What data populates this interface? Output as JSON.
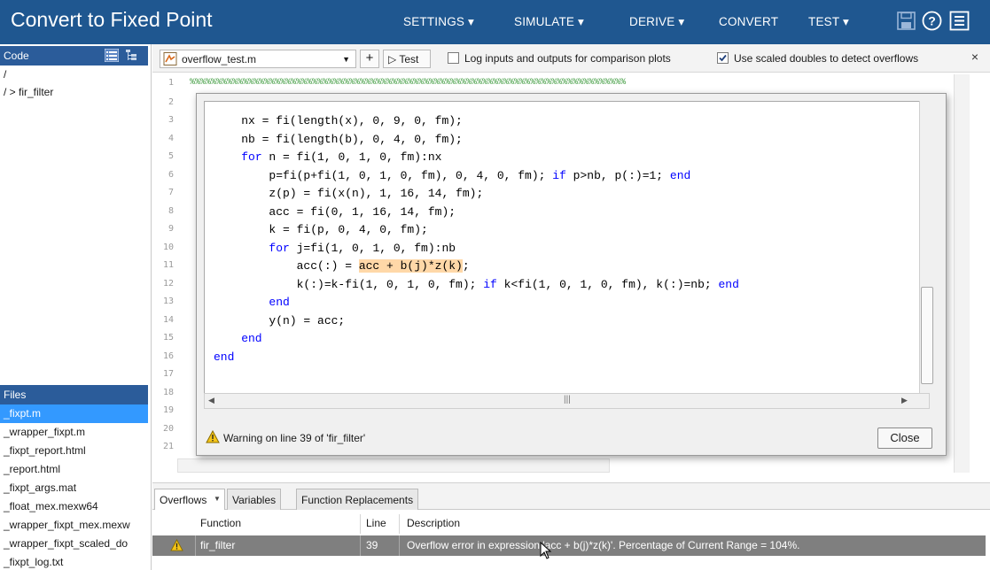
{
  "app": {
    "title": "Convert to Fixed Point"
  },
  "nav": {
    "settings": "SETTINGS ▾",
    "simulate": "SIMULATE ▾",
    "derive": "DERIVE ▾",
    "convert": "CONVERT",
    "test": "TEST ▾"
  },
  "left_panel": {
    "code_header": "Code",
    "tree": [
      "/",
      "/ > fir_filter"
    ],
    "files_header": "Files",
    "files": [
      "_fixpt.m",
      "_wrapper_fixpt.m",
      "_fixpt_report.html",
      "_report.html",
      "_fixpt_args.mat",
      "_float_mex.mexw64",
      "_wrapper_fixpt_mex.mexw",
      "_wrapper_fixpt_scaled_do",
      "_fixpt_log.txt"
    ]
  },
  "toolbar": {
    "file_name": "overflow_test.m",
    "add_label": "+",
    "test_label": "▷ Test",
    "log_checkbox_label": "Log inputs and outputs for comparison plots",
    "log_checked": false,
    "scaled_checkbox_label": "Use scaled doubles to detect overflows",
    "scaled_checked": true,
    "close_label": "×"
  },
  "editor": {
    "line_numbers": [
      "1",
      "2",
      "3",
      "4",
      "5",
      "6",
      "7",
      "8",
      "9",
      "10",
      "11",
      "12",
      "13",
      "14",
      "15",
      "16",
      "17",
      "18",
      "19",
      "20",
      "21"
    ],
    "first_line": "%%%%%%%%%%%%%%%%%%%%%%%%%%%%%%%%%%%%%%%%%%%%%%%%%%%%%%%%%%%%%%%%%%%%%%%%%%%%%%%%%%"
  },
  "popup": {
    "code_lines": [
      "    nx = fi(length(x), 0, 9, 0, fm);",
      "    nb = fi(length(b), 0, 4, 0, fm);",
      "    for n = fi(1, 0, 1, 0, fm):nx",
      "        p=fi(p+fi(1, 0, 1, 0, fm), 0, 4, 0, fm); if p>nb, p(:)=1; end",
      "        z(p) = fi(x(n), 1, 16, 14, fm);",
      "        acc = fi(0, 1, 16, 14, fm);",
      "        k = fi(p, 0, 4, 0, fm);",
      "        for j=fi(1, 0, 1, 0, fm):nb",
      "            acc(:) = acc + b(j)*z(k);",
      "            k(:)=k-fi(1, 0, 1, 0, fm); if k<fi(1, 0, 1, 0, fm), k(:)=nb; end",
      "        end",
      "        y(n) = acc;",
      "    end",
      "end"
    ],
    "warning": "Warning on line 39 of 'fir_filter'",
    "close_label": "Close"
  },
  "bottom": {
    "tabs": [
      "Overflows",
      "Variables",
      "Function Replacements"
    ],
    "columns": [
      "Function",
      "Line",
      "Description"
    ],
    "rows": [
      {
        "function": "fir_filter",
        "line": "39",
        "description": "Overflow error in expression 'acc + b(j)*z(k)'. Percentage of Current Range = 104%."
      }
    ]
  },
  "colors": {
    "topbar": "#1f5790",
    "panel_header": "#2b5c9a",
    "selected_file": "#3399ff",
    "keyword": "#0000ff",
    "highlight": "#ffd8a8",
    "selected_row": "#7f7f7f"
  }
}
